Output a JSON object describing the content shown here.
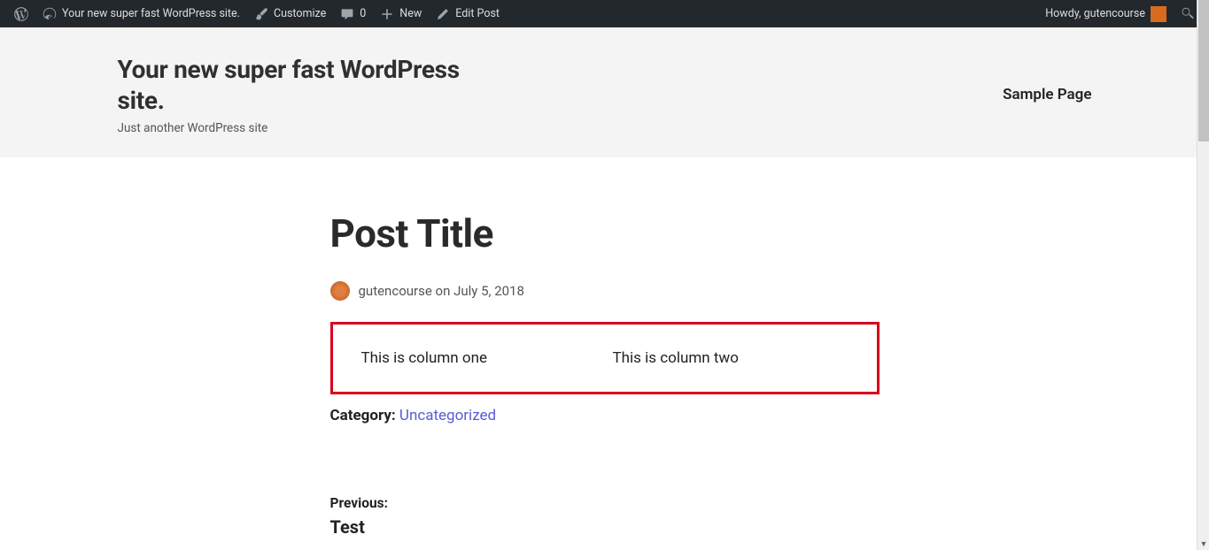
{
  "adminbar": {
    "site_name": "Your new super fast WordPress site.",
    "customize": "Customize",
    "comments_count": "0",
    "new": "New",
    "edit_post": "Edit Post",
    "greeting": "Howdy, gutencourse"
  },
  "header": {
    "site_title": "Your new super fast WordPress site.",
    "tagline": "Just another WordPress site",
    "nav": {
      "sample_page": "Sample Page"
    }
  },
  "post": {
    "title": "Post Title",
    "author": "gutencourse",
    "meta_joiner": " on ",
    "date": "July 5, 2018",
    "columns": [
      "This is column one",
      "This is column two"
    ],
    "category_label": "Category: ",
    "category_link": "Uncategorized"
  },
  "pagination": {
    "previous_label": "Previous:",
    "previous_title": "Test"
  },
  "colors": {
    "highlight_border": "#d9001c",
    "link": "#5b5bd6",
    "avatar": "#d86b1f"
  }
}
